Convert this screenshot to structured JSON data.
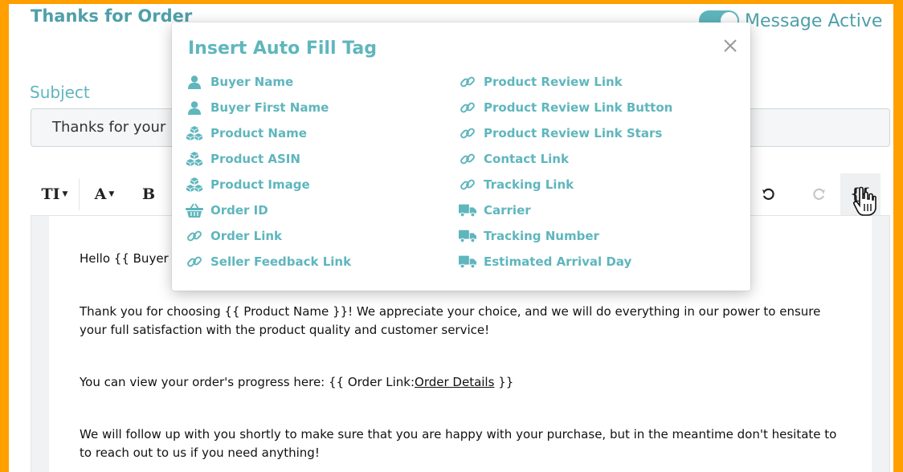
{
  "header": {
    "title": "Thanks for Order",
    "toggle_label": "Message Active"
  },
  "subject": {
    "label": "Subject",
    "value": "Thanks for your"
  },
  "toolbar": {
    "font_size_label": "TI",
    "font_color_label": "A",
    "bold_label": "B",
    "undo_icon": "undo-icon",
    "redo_icon": "redo-icon",
    "tag_button_label": "{{"
  },
  "editor": {
    "greeting": "Hello {{ Buyer F",
    "para1": "Thank you for choosing {{ Product Name }}! We appreciate your choice, and we will do everything in our power to ensure your full satisfaction with the product quality and customer service!",
    "para2_prefix": "You can view your order's progress here: {{ Order Link:",
    "para2_link": "Order Details",
    "para2_suffix": " }}",
    "para3": "We will follow up with you shortly to make sure that you are happy with your purchase, but in the meantime don't hesitate to to reach out to us if you need anything!"
  },
  "modal": {
    "title": "Insert Auto Fill Tag",
    "left_tags": [
      {
        "label": "Buyer Name",
        "icon": "user-icon"
      },
      {
        "label": "Buyer First Name",
        "icon": "user-icon"
      },
      {
        "label": "Product Name",
        "icon": "cubes-icon"
      },
      {
        "label": "Product ASIN",
        "icon": "cubes-icon"
      },
      {
        "label": "Product Image",
        "icon": "cubes-icon"
      },
      {
        "label": "Order ID",
        "icon": "basket-icon"
      },
      {
        "label": "Order Link",
        "icon": "link-icon"
      },
      {
        "label": "Seller Feedback Link",
        "icon": "link-icon"
      }
    ],
    "right_tags": [
      {
        "label": "Product Review Link",
        "icon": "link-icon"
      },
      {
        "label": "Product Review Link Button",
        "icon": "link-icon"
      },
      {
        "label": "Product Review Link Stars",
        "icon": "link-icon"
      },
      {
        "label": "Contact Link",
        "icon": "link-icon"
      },
      {
        "label": "Tracking Link",
        "icon": "link-icon"
      },
      {
        "label": "Carrier",
        "icon": "truck-icon"
      },
      {
        "label": "Tracking Number",
        "icon": "truck-icon"
      },
      {
        "label": "Estimated Arrival Day",
        "icon": "truck-icon"
      }
    ]
  },
  "colors": {
    "accent": "#5fb6bd",
    "title": "#4f9faa",
    "frame": "#ff9f00"
  }
}
